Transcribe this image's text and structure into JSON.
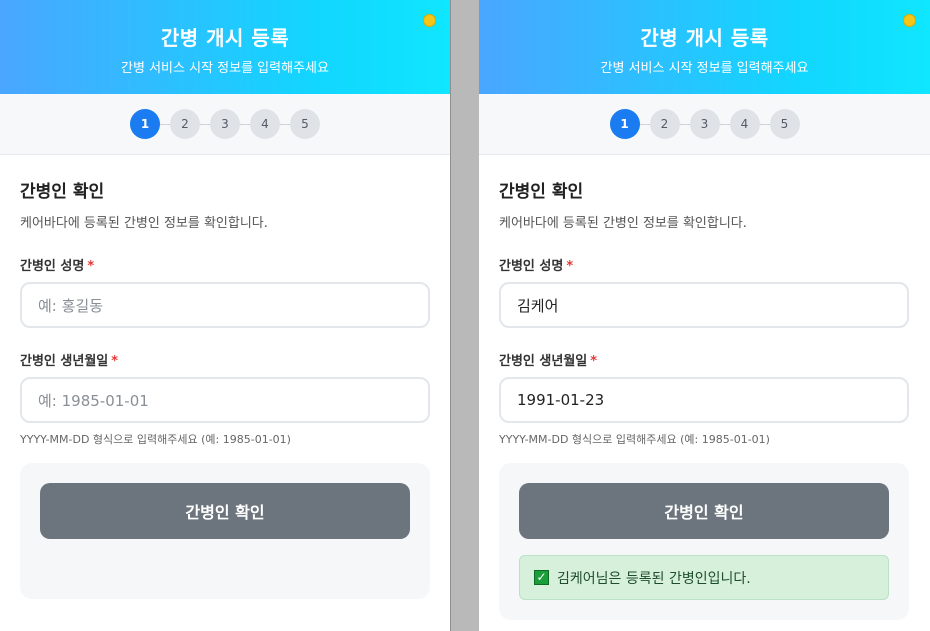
{
  "header": {
    "title": "간병 개시 등록",
    "subtitle": "간병 서비스 시작 정보를 입력해주세요"
  },
  "steps": [
    "1",
    "2",
    "3",
    "4",
    "5"
  ],
  "current_step": 1,
  "colors": {
    "header_gradient_start": "#4aa6ff",
    "header_gradient_end": "#0fe6ff",
    "active_step": "#1a7cf0",
    "button": "#6c757d",
    "success_bg": "#d6f0dc",
    "required": "#e53935"
  },
  "section": {
    "title": "간병인 확인",
    "description": "케어바다에 등록된 간병인 정보를 확인합니다."
  },
  "fields": {
    "name_label": "간병인 성명",
    "name_placeholder": "예: 홍길동",
    "birth_label": "간병인 생년월일",
    "birth_placeholder": "예: 1985-01-01",
    "required_mark": "*",
    "birth_hint": "YYYY-MM-DD 형식으로 입력해주세요 (예: 1985-01-01)"
  },
  "button_label": "간병인 확인",
  "filled": {
    "name_value": "김케어",
    "birth_value": "1991-01-23",
    "success_message": "김케어님은 등록된 간병인입니다.",
    "success_icon": "check-box-icon"
  }
}
